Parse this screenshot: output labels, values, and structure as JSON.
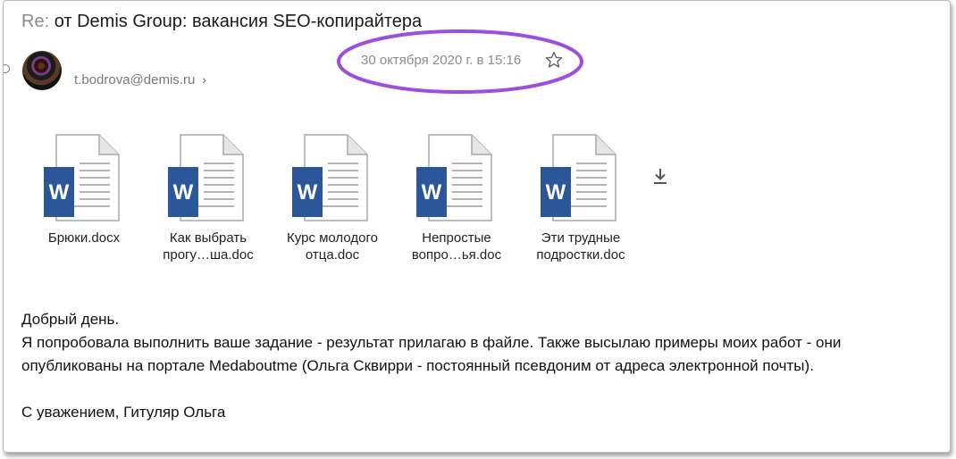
{
  "email": {
    "subject_prefix": "Re:",
    "subject": "от Demis Group: вакансия SEO-копирайтера",
    "sender": "t.bodrova@demis.ru",
    "date": "30 октября 2020 г. в 15:16"
  },
  "attachments": [
    {
      "name_line1": "Брюки.docx",
      "name_line2": "",
      "icon": "word-doc-icon"
    },
    {
      "name_line1": "Как выбрать",
      "name_line2": "прогу…ша.doc",
      "icon": "word-doc-icon"
    },
    {
      "name_line1": "Курс молодого",
      "name_line2": "отца.doc",
      "icon": "word-doc-icon"
    },
    {
      "name_line1": "Непростые",
      "name_line2": "вопро…ья.doc",
      "icon": "word-doc-icon"
    },
    {
      "name_line1": "Эти трудные",
      "name_line2": "подростки.doc",
      "icon": "word-doc-icon"
    }
  ],
  "body": {
    "greeting": "Добрый день.",
    "line1": "Я попробовала выполнить ваше задание - результат прилагаю в файле. Также высылаю примеры моих работ - они",
    "line2": "опубликованы на портале Medaboutme (Ольга Сквирри - постоянный псевдоним от адреса электронной почты).",
    "signature": "С уважением, Гитуляр Ольга"
  },
  "colors": {
    "highlight_ellipse": "#9b4ee0",
    "word_blue": "#2b579a"
  }
}
